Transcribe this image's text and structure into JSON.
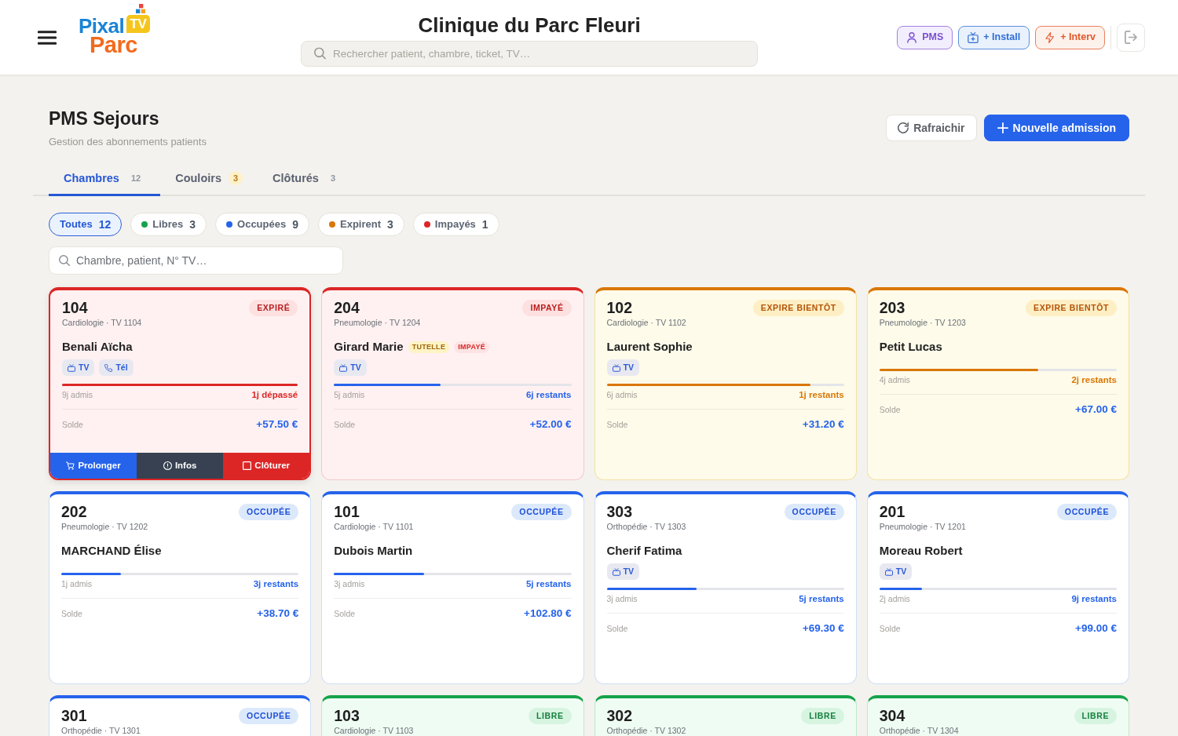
{
  "header": {
    "logo": {
      "line_1": "Pixal",
      "badge": "TV",
      "line_2": "Parc"
    },
    "title": "Clinique du Parc Fleuri",
    "search": {
      "placeholder": "Rechercher patient, chambre, ticket, TV…"
    },
    "actions": [
      {
        "label": "PMS",
        "kind": "pms"
      },
      {
        "label": "+ Install",
        "kind": "install"
      },
      {
        "label": "+ Interv",
        "kind": "intervention"
      },
      {
        "kind": "logout"
      }
    ]
  },
  "page": {
    "title": "PMS Sejours",
    "subtitle": "Gestion des abonnements patients",
    "buttons": [
      {
        "label": "Rafraichir",
        "kind": "refresh"
      },
      {
        "label": "Nouvelle admission",
        "kind": "primary"
      }
    ]
  },
  "tabs": [
    {
      "label": "Chambres",
      "count": "12",
      "selected": true,
      "alert": false
    },
    {
      "label": "Couloirs",
      "count": "3",
      "selected": false,
      "alert": true
    },
    {
      "label": "Clôturés",
      "count": "3",
      "selected": false,
      "alert": false
    }
  ],
  "filters": [
    {
      "label": "Toutes",
      "count": "12",
      "selected": true
    },
    {
      "label": "Libres",
      "count": "3",
      "color": "#16a34a",
      "selected": false
    },
    {
      "label": "Occupées",
      "count": "9",
      "color": "#2563eb",
      "selected": false
    },
    {
      "label": "Expirent",
      "count": "3",
      "color": "#d97706",
      "selected": false
    },
    {
      "label": "Impayés",
      "count": "1",
      "color": "#dc2626",
      "selected": false
    }
  ],
  "room_search": {
    "placeholder": "Chambre, patient, N° TV…"
  },
  "rooms": [
    {
      "number": "104",
      "subtitle": "Cardiologie · TV 1104",
      "status": {
        "label": "EXPIRÉ",
        "kind": "expired"
      },
      "selected": true,
      "patient": "Benali Aïcha",
      "services": [
        {
          "label": "TV",
          "kind": "tv"
        },
        {
          "label": "Tél",
          "kind": "phone"
        }
      ],
      "stay": {
        "level": 1,
        "kind": "overdue",
        "elapsed": "9j admis",
        "remaining": "1j dépassé"
      },
      "balance": {
        "label": "Solde",
        "amount": "+57.50 €"
      },
      "actions": [
        {
          "label": "Prolonger",
          "kind": "extend"
        },
        {
          "label": "Infos",
          "kind": "info"
        },
        {
          "label": "Clôturer",
          "kind": "close"
        }
      ]
    },
    {
      "number": "204",
      "subtitle": "Pneumologie · TV 1204",
      "status": {
        "label": "IMPAYÉ",
        "kind": "unpaid"
      },
      "selected": false,
      "patient": "Girard Marie",
      "tags": [
        {
          "label": "TUTELLE",
          "kind": "guardianship"
        },
        {
          "label": "IMPAYÉ",
          "kind": "unpaid"
        }
      ],
      "services": [
        {
          "label": "TV",
          "kind": "tv"
        }
      ],
      "stay": {
        "level": 0.45,
        "kind": "normal",
        "elapsed": "5j admis",
        "remaining": "6j restants"
      },
      "balance": {
        "label": "Solde",
        "amount": "+52.00 €"
      }
    },
    {
      "number": "102",
      "subtitle": "Cardiologie · TV 1102",
      "status": {
        "label": "EXPIRE BIENTÔT",
        "kind": "expiring"
      },
      "selected": false,
      "patient": "Laurent Sophie",
      "services": [
        {
          "label": "TV",
          "kind": "tv"
        }
      ],
      "stay": {
        "level": 0.86,
        "kind": "expiring",
        "elapsed": "6j admis",
        "remaining": "1j restants"
      },
      "balance": {
        "label": "Solde",
        "amount": "+31.20 €"
      }
    },
    {
      "number": "203",
      "subtitle": "Pneumologie · TV 1203",
      "status": {
        "label": "EXPIRE BIENTÔT",
        "kind": "expiring"
      },
      "selected": false,
      "patient": "Petit Lucas",
      "stay": {
        "level": 0.67,
        "kind": "expiring",
        "elapsed": "4j admis",
        "remaining": "2j restants"
      },
      "balance": {
        "label": "Solde",
        "amount": "+67.00 €"
      }
    },
    {
      "number": "202",
      "subtitle": "Pneumologie · TV 1202",
      "status": {
        "label": "OCCUPÉE",
        "kind": "occupied"
      },
      "selected": false,
      "patient": "MARCHAND Élise",
      "stay": {
        "level": 0.25,
        "kind": "normal",
        "elapsed": "1j admis",
        "remaining": "3j restants"
      },
      "balance": {
        "label": "Solde",
        "amount": "+38.70 €"
      }
    },
    {
      "number": "101",
      "subtitle": "Cardiologie · TV 1101",
      "status": {
        "label": "OCCUPÉE",
        "kind": "occupied"
      },
      "selected": false,
      "patient": "Dubois Martin",
      "stay": {
        "level": 0.38,
        "kind": "normal",
        "elapsed": "3j admis",
        "remaining": "5j restants"
      },
      "balance": {
        "label": "Solde",
        "amount": "+102.80 €"
      }
    },
    {
      "number": "303",
      "subtitle": "Orthopédie · TV 1303",
      "status": {
        "label": "OCCUPÉE",
        "kind": "occupied"
      },
      "selected": false,
      "patient": "Cherif Fatima",
      "services": [
        {
          "label": "TV",
          "kind": "tv"
        }
      ],
      "stay": {
        "level": 0.38,
        "kind": "normal",
        "elapsed": "3j admis",
        "remaining": "5j restants"
      },
      "balance": {
        "label": "Solde",
        "amount": "+69.30 €"
      }
    },
    {
      "number": "201",
      "subtitle": "Pneumologie · TV 1201",
      "status": {
        "label": "OCCUPÉE",
        "kind": "occupied"
      },
      "selected": false,
      "patient": "Moreau Robert",
      "services": [
        {
          "label": "TV",
          "kind": "tv"
        }
      ],
      "stay": {
        "level": 0.18,
        "kind": "normal",
        "elapsed": "2j admis",
        "remaining": "9j restants"
      },
      "balance": {
        "label": "Solde",
        "amount": "+99.00 €"
      }
    },
    {
      "number": "301",
      "subtitle": "Orthopédie · TV 1301",
      "status": {
        "label": "OCCUPÉE",
        "kind": "occupied"
      },
      "selected": false
    },
    {
      "number": "103",
      "subtitle": "Cardiologie · TV 1103",
      "status": {
        "label": "LIBRE",
        "kind": "free"
      },
      "selected": false
    },
    {
      "number": "302",
      "subtitle": "Orthopédie · TV 1302",
      "status": {
        "label": "LIBRE",
        "kind": "free"
      },
      "selected": false
    },
    {
      "number": "304",
      "subtitle": "Orthopédie · TV 1304",
      "status": {
        "label": "LIBRE",
        "kind": "free"
      },
      "selected": false
    }
  ]
}
